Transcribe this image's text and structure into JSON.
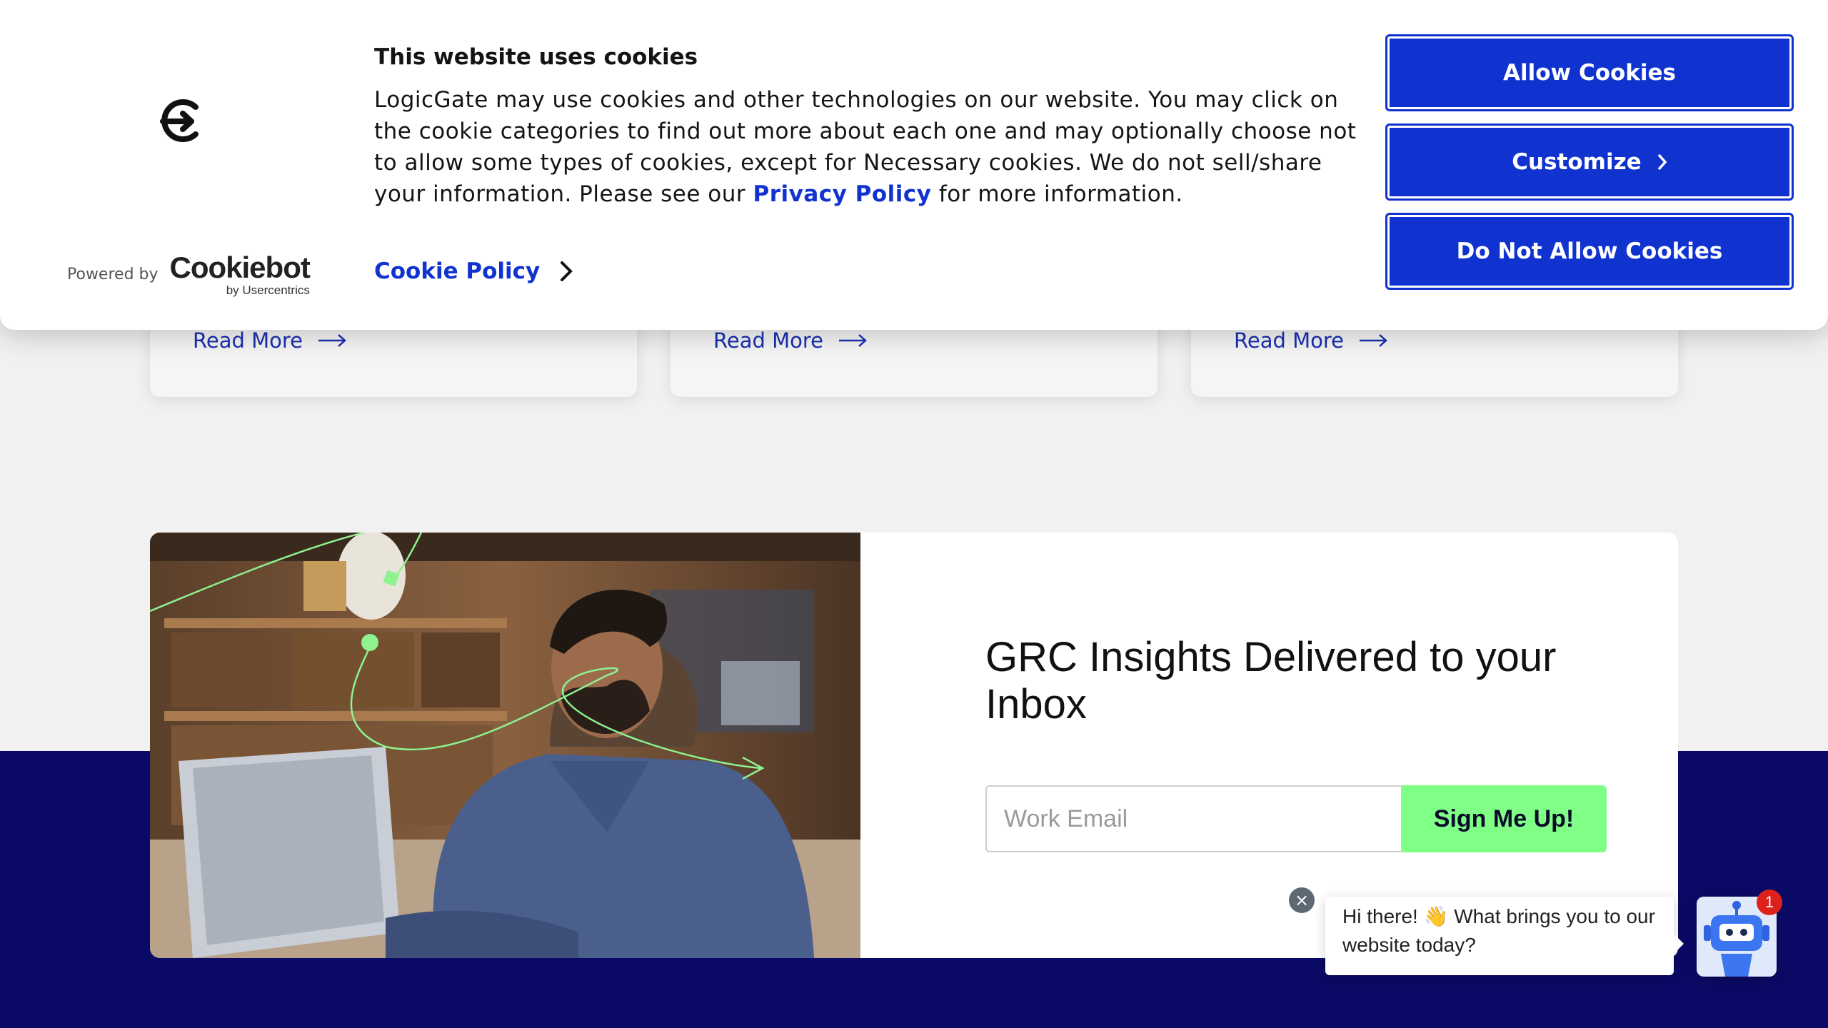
{
  "cookie_banner": {
    "title": "This website uses cookies",
    "text_before_link": "LogicGate may use cookies and other technologies on our website. You may click on the cookie categories to find out more about each one and may optionally choose not to allow some types of cookies, except for Necessary cookies.  We do not sell/share your information. Please see our ",
    "privacy_link": "Privacy Policy",
    "text_after_link": " for more information.",
    "cookie_policy_link": "Cookie Policy",
    "powered_by": "Powered by",
    "cookiebot_brand": "Cookiebot",
    "cookiebot_sub": "by Usercentrics",
    "buttons": {
      "allow": "Allow Cookies",
      "customize": "Customize",
      "deny": "Do Not Allow Cookies"
    },
    "accent_color": "#1032cf"
  },
  "cards": [
    {
      "read_more": "Read More"
    },
    {
      "read_more": "Read More"
    },
    {
      "read_more": "Read More"
    }
  ],
  "signup": {
    "title": "GRC Insights Delivered to your Inbox",
    "email_placeholder": "Work Email",
    "button": "Sign Me Up!",
    "button_color": "#80ff86"
  },
  "chat": {
    "message": "Hi there! 👋 What brings you to our website today?",
    "badge_count": "1",
    "close_symbol": "×"
  },
  "colors": {
    "navy": "#0a0a66",
    "page_bg": "#f1f1f1"
  }
}
